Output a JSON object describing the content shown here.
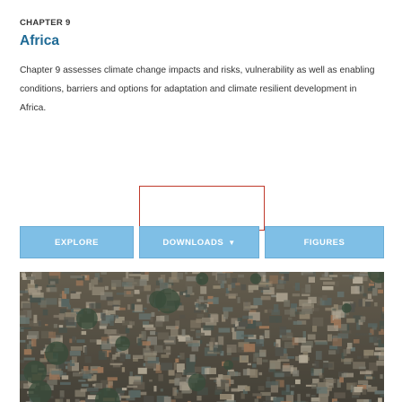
{
  "chapter": {
    "label": "CHAPTER 9",
    "title": "Africa",
    "description": "Chapter 9 assesses climate change impacts and risks, vulnerability as well as enabling conditions, barriers and options for adaptation and climate resilient development in Africa."
  },
  "buttons": {
    "explore": "EXPLORE",
    "downloads": "DOWNLOADS",
    "figures": "FIGURES"
  },
  "icons": {
    "downloads_dropdown": "chevron-down-icon"
  },
  "colors": {
    "title": "#1f6a95",
    "button_bg": "#7fbfe6",
    "focus_outline": "#c0392b"
  }
}
